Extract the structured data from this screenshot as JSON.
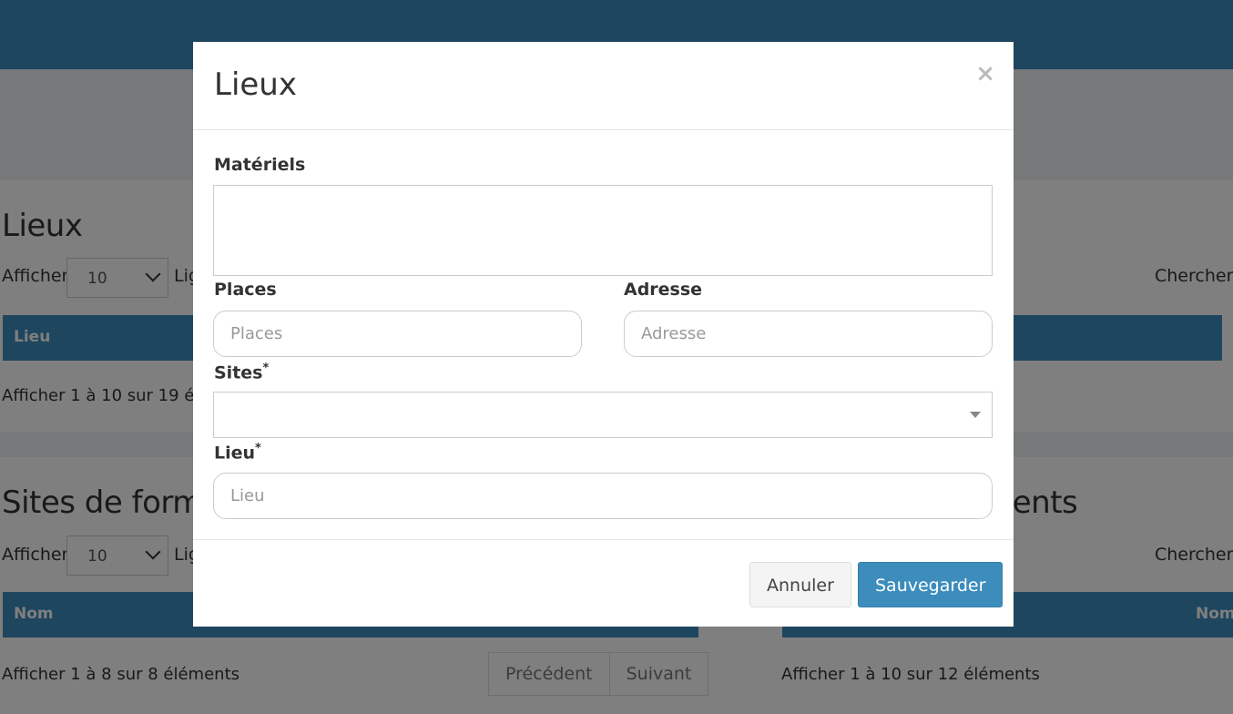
{
  "background": {
    "lieux": {
      "title": "Lieux",
      "afficher": "Afficher",
      "length_value": "10",
      "lig": "Lig",
      "chercher": "Chercher",
      "column": "Lieu",
      "info": "Afficher 1 à 10 sur 19 élé"
    },
    "sites": {
      "title": "Sites de forma",
      "afficher": "Afficher",
      "length_value": "10",
      "lig": "Lig",
      "column": "Nom",
      "info": "Afficher 1 à 8 sur 8 éléments",
      "prev": "Précédent",
      "next": "Suivant"
    },
    "referents": {
      "title": "rents",
      "chercher": "Chercher",
      "column": "Nom",
      "info": "Afficher 1 à 10 sur 12 éléments"
    }
  },
  "modal": {
    "title": "Lieux",
    "close": "×",
    "materiels_label": "Matériels",
    "places_label": "Places",
    "places_placeholder": "Places",
    "adresse_label": "Adresse",
    "adresse_placeholder": "Adresse",
    "sites_label": "Sites",
    "lieu_label": "Lieu",
    "lieu_placeholder": "Lieu",
    "required_mark": "*",
    "cancel": "Annuler",
    "save": "Sauvegarder"
  },
  "colors": {
    "primary": "#3c8dbc",
    "overlay": "rgba(0,0,0,0.5)"
  }
}
